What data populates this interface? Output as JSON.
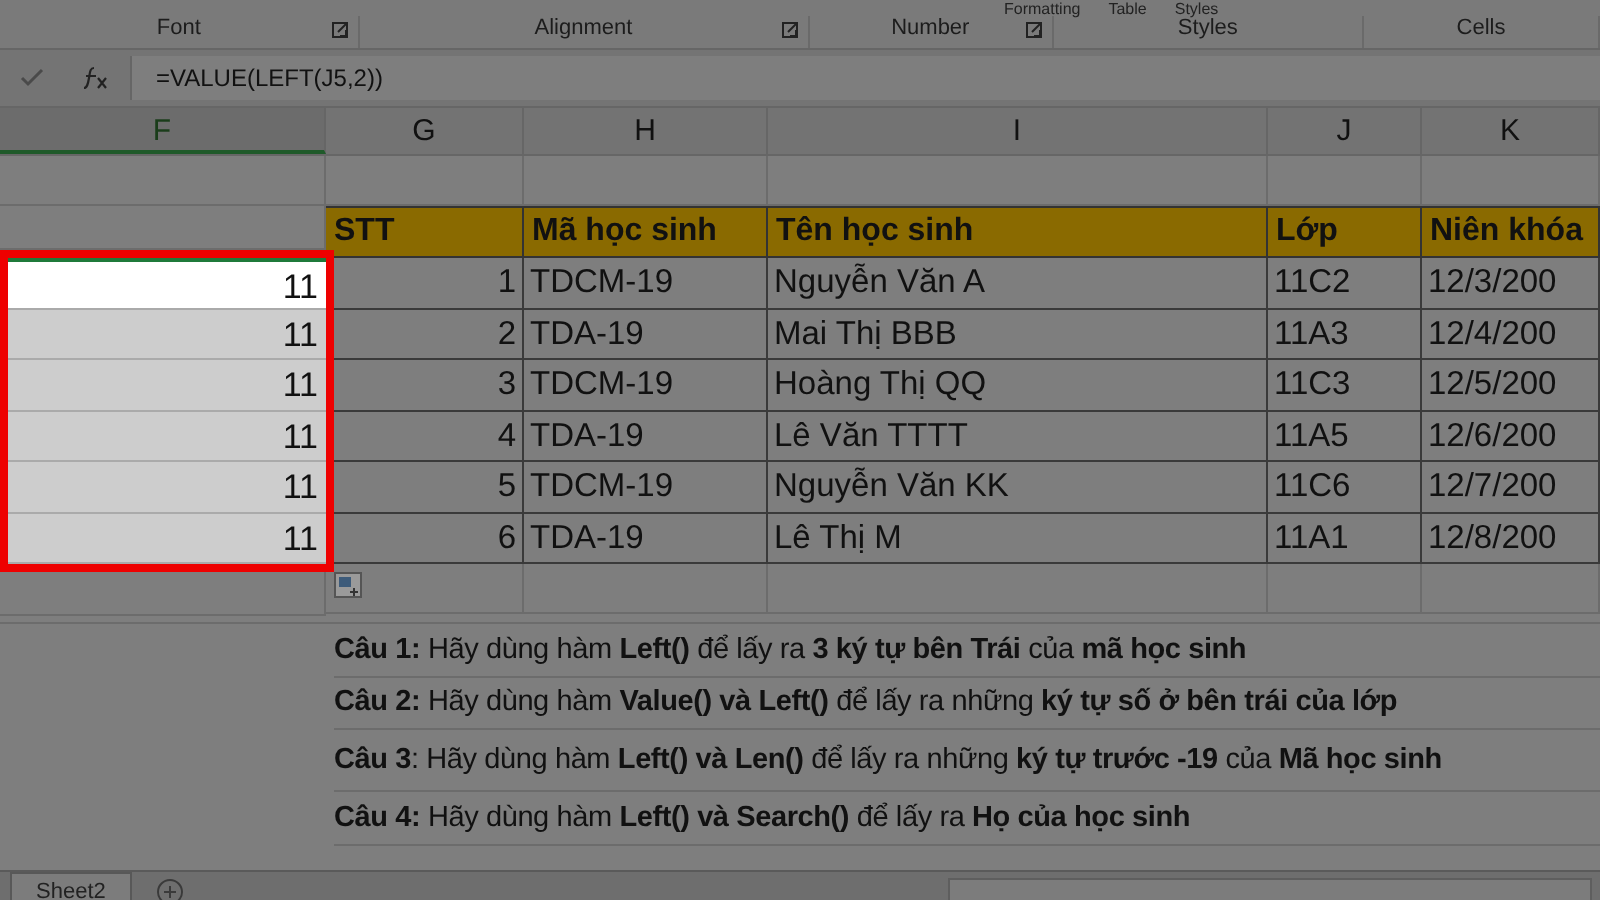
{
  "ribbon": {
    "cut_labels": [
      "Formatting",
      "Table",
      "Styles"
    ],
    "groups": [
      {
        "label": "Font"
      },
      {
        "label": "Alignment"
      },
      {
        "label": "Number"
      },
      {
        "label": "Styles"
      },
      {
        "label": "Cells"
      }
    ]
  },
  "formula_bar": {
    "formula": "=VALUE(LEFT(J5,2))"
  },
  "columns": [
    {
      "label": "F",
      "selected": true
    },
    {
      "label": "G",
      "selected": false
    },
    {
      "label": "H",
      "selected": false
    },
    {
      "label": "I",
      "selected": false
    },
    {
      "label": "J",
      "selected": false
    },
    {
      "label": "K",
      "selected": false
    }
  ],
  "table": {
    "headers": [
      "STT",
      "Mã học sinh",
      "Tên học sinh",
      "Lớp",
      "Niên khóa"
    ],
    "rows": [
      {
        "result": "11",
        "active": true,
        "cells": [
          "1",
          "TDCM-19",
          "Nguyễn Văn A",
          "11C2",
          "12/3/200"
        ]
      },
      {
        "result": "11",
        "active": false,
        "cells": [
          "2",
          "TDA-19",
          "Mai Thị BBB",
          "11A3",
          "12/4/200"
        ]
      },
      {
        "result": "11",
        "active": false,
        "cells": [
          "3",
          "TDCM-19",
          "Hoàng Thị QQ",
          "11C3",
          "12/5/200"
        ]
      },
      {
        "result": "11",
        "active": false,
        "cells": [
          "4",
          "TDA-19",
          "Lê Văn TTTT",
          "11A5",
          "12/6/200"
        ]
      },
      {
        "result": "11",
        "active": false,
        "cells": [
          "5",
          "TDCM-19",
          "Nguyễn Văn KK",
          "11C6",
          "12/7/200"
        ]
      },
      {
        "result": "11",
        "active": false,
        "cells": [
          "6",
          "TDA-19",
          "Lê Thị M",
          "11A1",
          "12/8/200"
        ]
      }
    ]
  },
  "questions": [
    "**Câu 1:** Hãy dùng hàm **Left()** để lấy ra **3 ký tự bên Trái** của **mã học sinh**",
    "**Câu 2:** Hãy dùng hàm **Value() và Left()** để lấy ra những **ký tự số ở bên trái của lớp**",
    "**Câu 3**: Hãy dùng hàm **Left() và Len()** để lấy ra  những **ký tự trước -19** của **Mã học sinh**",
    "**Câu 4:** Hãy dùng hàm **Left() và Search()** để lấy ra **Họ của học sinh**"
  ],
  "sheet_tabs": [
    {
      "label": "Sheet2",
      "selected": true
    }
  ]
}
